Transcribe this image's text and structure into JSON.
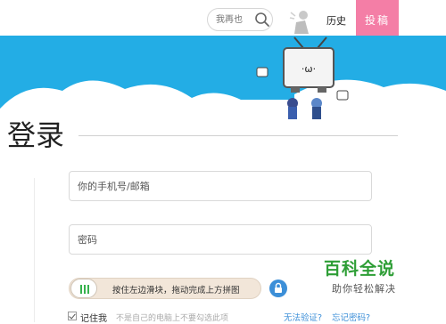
{
  "header": {
    "search_placeholder": "我再也",
    "history_label": "历史",
    "upload_label": "投稿"
  },
  "page": {
    "title": "登录"
  },
  "form": {
    "phone_placeholder": "你的手机号/邮箱",
    "password_placeholder": "密码",
    "slider_text": "按住左边滑块，拖动完成上方拼图",
    "remember_label": "记住我",
    "remember_hint": "不是自己的电脑上不要勾选此项",
    "cant_verify_link": "无法验证?",
    "forgot_password_link": "忘记密码?"
  },
  "watermark": {
    "title": "百科全说",
    "subtitle": "助你轻松解决"
  },
  "colors": {
    "banner_blue": "#23ade5",
    "upload_pink": "#f47ea6",
    "link_blue": "#3c8fd8",
    "watermark_green": "#2e9e36"
  },
  "icons": [
    "search-icon",
    "avatar-icon",
    "mascot-illustration",
    "lock-icon",
    "checkbox-icon"
  ]
}
